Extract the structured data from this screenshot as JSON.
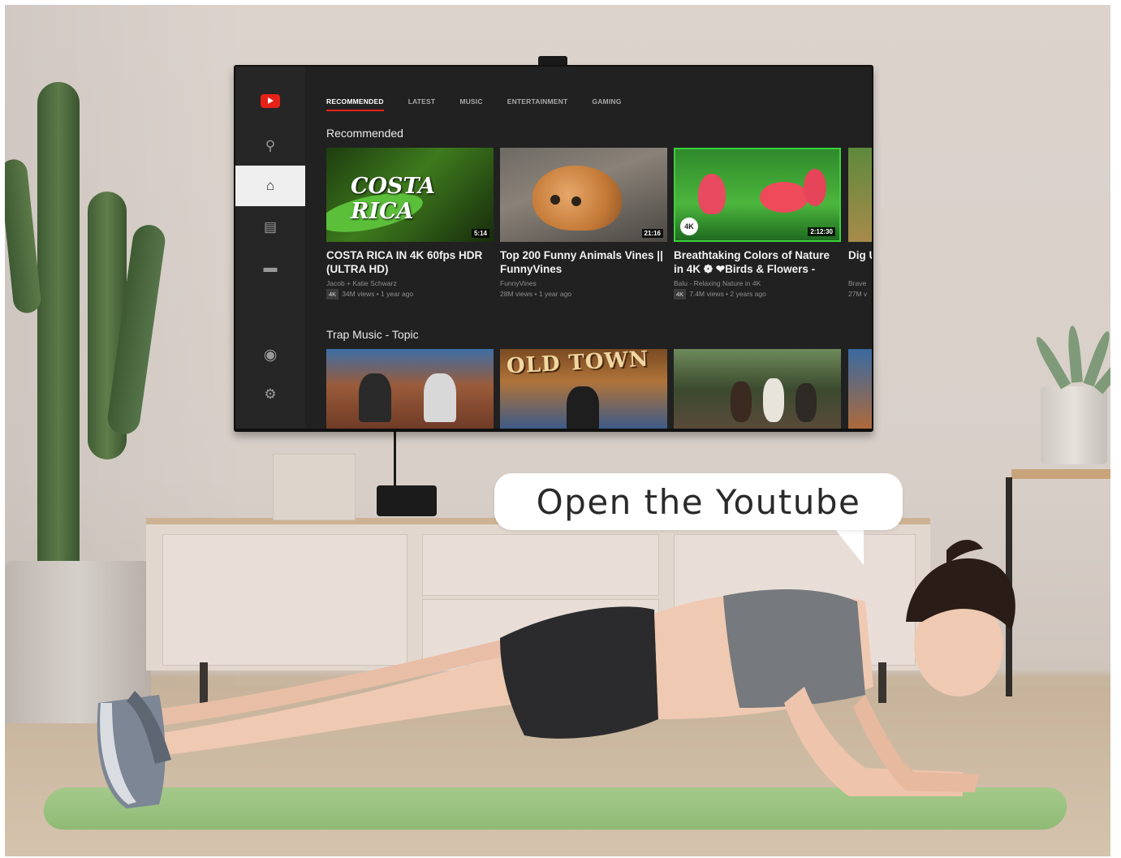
{
  "tv": {
    "tabs": [
      "RECOMMENDED",
      "LATEST",
      "MUSIC",
      "ENTERTAINMENT",
      "GAMING"
    ],
    "active_tab": "RECOMMENDED",
    "sidebar_icons": [
      "youtube-logo",
      "search-icon",
      "home-icon",
      "subscriptions-icon",
      "library-icon",
      "account-icon",
      "settings-icon"
    ],
    "rows": [
      {
        "title": "Recommended",
        "cards": [
          {
            "thumb_text": "COSTA RICA",
            "duration": "5:14",
            "title": "COSTA RICA IN 4K 60fps HDR (ULTRA HD)",
            "channel": "Jacob + Katie Schwarz",
            "badge": "4K",
            "stats": "34M views • 1 year ago"
          },
          {
            "thumb_text": "",
            "duration": "21:16",
            "title": "Top 200 Funny Animals Vines || FunnyVines",
            "channel": "FunnyVines",
            "badge": "",
            "stats": "28M views • 1 year ago"
          },
          {
            "thumb_text": "4K",
            "duration": "2:12:30",
            "title": "Breathtaking Colors of Nature in 4K ❁ ❤Birds & Flowers -",
            "channel": "Balu - Relaxing Nature in 4K",
            "badge": "4K",
            "stats": "7.4M views • 2 years ago"
          },
          {
            "thumb_text": "",
            "duration": "",
            "title": "Dig Und",
            "channel": "Brave",
            "badge": "",
            "stats": "27M v"
          }
        ]
      },
      {
        "title": "Trap Music - Topic",
        "cards": [
          {
            "thumb_text": "",
            "duration": ""
          },
          {
            "thumb_text": "OLD TOWN",
            "duration": ""
          },
          {
            "thumb_text": "",
            "duration": ""
          },
          {
            "thumb_text": "",
            "duration": ""
          }
        ]
      }
    ],
    "accent_color": "#e62117"
  },
  "bubble": {
    "text": "Open the Youtube"
  }
}
